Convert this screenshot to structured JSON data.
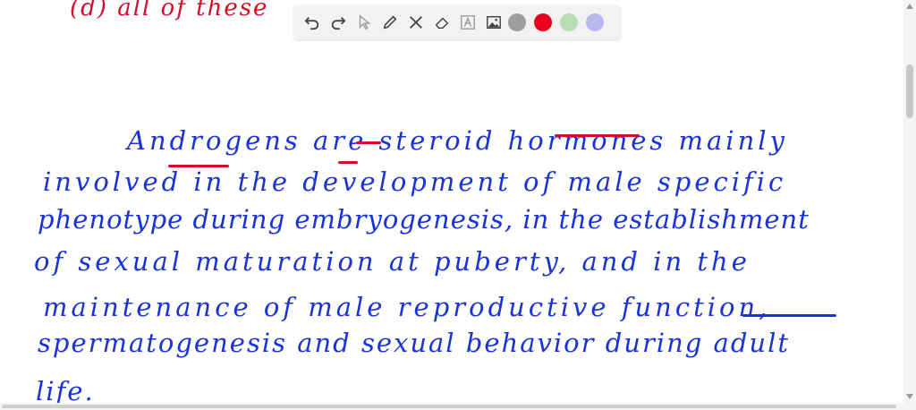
{
  "top_note": "(d) all of these",
  "paragraph": [
    "Androgens are steroid hormones mainly",
    "involved in the development of male specific",
    "phenotype during embryogenesis, in the establishment",
    "of sexual maturation at puberty, and in the",
    "maintenance of male reproductive function,",
    "spermatogenesis and sexual behavior during adult",
    "life."
  ],
  "toolbar": {
    "tools": [
      "undo-icon",
      "redo-icon",
      "select-icon",
      "pen-icon",
      "tools-icon",
      "eraser-icon",
      "text-icon",
      "image-icon"
    ],
    "colors": [
      "#9e9e9e",
      "#e8001c",
      "#b6dfb0",
      "#b9b7ec"
    ]
  },
  "colors": {
    "red_ink": "#d10f2b",
    "blue_ink": "#1a33d6"
  }
}
